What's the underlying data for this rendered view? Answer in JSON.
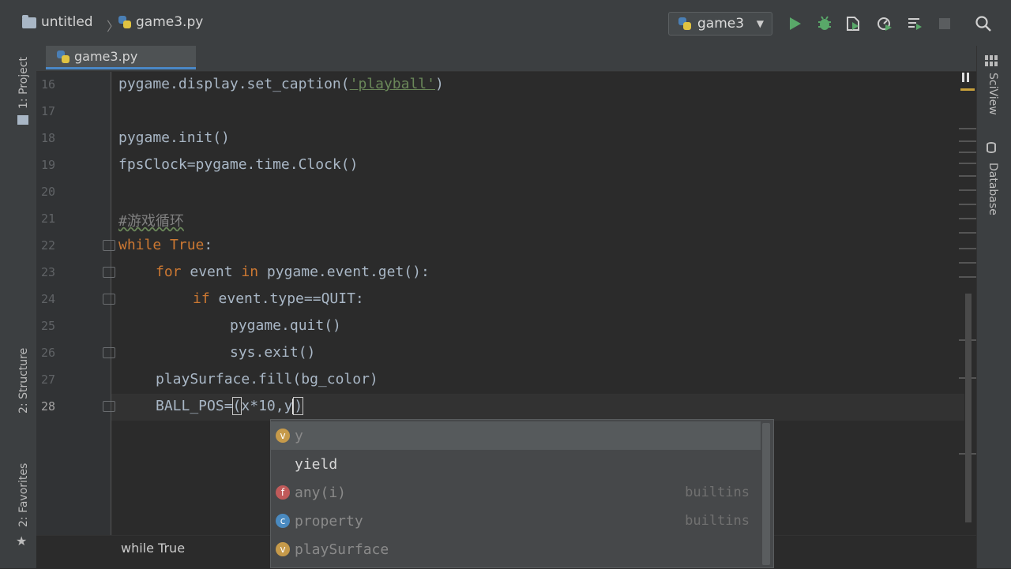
{
  "header": {
    "project_name": "untitled",
    "file_breadcrumb": "game3.py",
    "run_config": "game3",
    "toolbar_icons": [
      "run-icon",
      "debug-icon",
      "coverage-icon",
      "profile-icon",
      "build-icon",
      "stop-icon",
      "search-icon"
    ]
  },
  "tabs": [
    {
      "label": "game3.py"
    }
  ],
  "left_tools": {
    "project": "1: Project",
    "structure": "2: Structure",
    "favorites": "2: Favorites"
  },
  "right_tools": {
    "sciview": "SciView",
    "database": "Database"
  },
  "editor": {
    "line_numbers": [
      "16",
      "17",
      "18",
      "19",
      "20",
      "21",
      "22",
      "23",
      "24",
      "25",
      "26",
      "27",
      "28"
    ],
    "lines": {
      "l16a": "pygame.display.set_caption(",
      "l16s": "'playball'",
      "l16b": ")",
      "l18": "pygame.init()",
      "l19": "fpsClock=pygame.time.Clock()",
      "l21": "#游戏循环",
      "l22k": "while True",
      "l22b": ":",
      "l23k1": "for",
      "l23a": " event ",
      "l23k2": "in",
      "l23b": " pygame.event.get():",
      "l24k": "if",
      "l24a": " event.type==QUIT:",
      "l25": "pygame.quit()",
      "l26": "sys.exit()",
      "l27": "playSurface.fill(bg_color)",
      "l28a": "BALL_POS=",
      "l28b": "(",
      "l28c": "x*10,y",
      "l28d": ")"
    }
  },
  "completion": {
    "items": [
      {
        "label": "y",
        "type": "",
        "icon": "v"
      },
      {
        "label": "yield",
        "type": "",
        "icon": ""
      },
      {
        "label": "any(i)",
        "type": "builtins",
        "icon": "f"
      },
      {
        "label": "property",
        "type": "builtins",
        "icon": "c"
      },
      {
        "label": "playSurface",
        "type": "",
        "icon": "v"
      }
    ],
    "icon_colors": {
      "v": "#c69a4a",
      "f": "#c05a5a",
      "c": "#4a8ac0"
    }
  },
  "status_breadcrumb": "while True"
}
